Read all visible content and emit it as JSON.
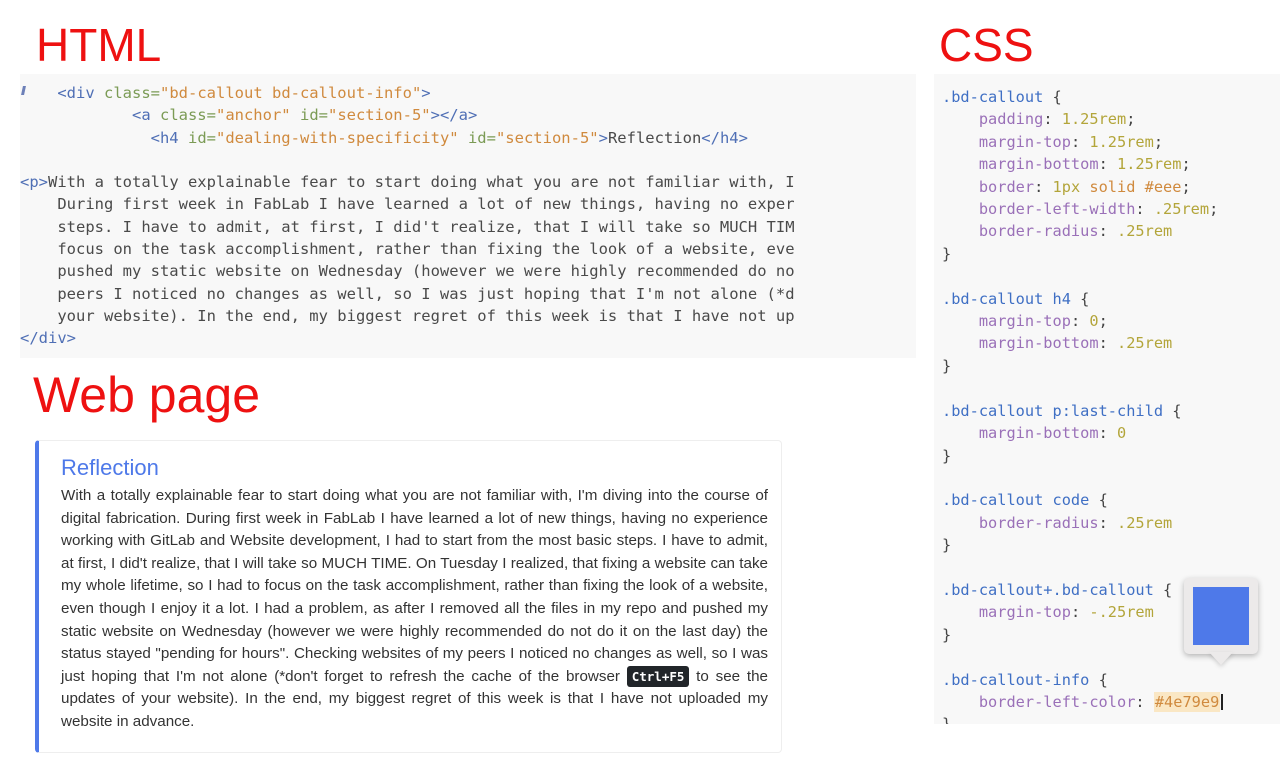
{
  "headings": {
    "html": "HTML",
    "css": "CSS",
    "webpage": "Web page"
  },
  "colors": {
    "heading_red": "#ee1111",
    "callout_border_left": "#4e79e9",
    "callout_heading": "#4e79e9",
    "code_panel_bg": "#f8f8f8",
    "kbd_bg": "#212529",
    "hex_highlight_bg": "#fae7c4"
  },
  "html_panel": {
    "lines": [
      {
        "indent": 0,
        "parts": [
          {
            "t": "tag",
            "v": "    <div "
          },
          {
            "t": "attr",
            "v": "class="
          },
          {
            "t": "str",
            "v": "\"bd-callout bd-callout-info\""
          },
          {
            "t": "tag",
            "v": ">"
          }
        ]
      },
      {
        "indent": 0,
        "parts": [
          {
            "t": "tag",
            "v": "            <a "
          },
          {
            "t": "attr",
            "v": "class="
          },
          {
            "t": "str",
            "v": "\"anchor\" "
          },
          {
            "t": "attr",
            "v": "id="
          },
          {
            "t": "str",
            "v": "\"section-5\""
          },
          {
            "t": "tag",
            "v": "></a>"
          }
        ]
      },
      {
        "indent": 0,
        "parts": [
          {
            "t": "tag",
            "v": "              <h4 "
          },
          {
            "t": "attr",
            "v": "id="
          },
          {
            "t": "str",
            "v": "\"dealing-with-specificity\" "
          },
          {
            "t": "attr",
            "v": "id="
          },
          {
            "t": "str",
            "v": "\"section-5\""
          },
          {
            "t": "tag",
            "v": ">"
          },
          {
            "t": "plain",
            "v": "Reflection"
          },
          {
            "t": "tag",
            "v": "</h4>"
          }
        ]
      },
      {
        "indent": 0,
        "parts": []
      },
      {
        "indent": 0,
        "parts": [
          {
            "t": "tag",
            "v": "<p>"
          },
          {
            "t": "plain",
            "v": "With a totally explainable fear to start doing what you are not familiar with, I"
          }
        ]
      },
      {
        "indent": 0,
        "parts": [
          {
            "t": "plain",
            "v": "    During first week in FabLab I have learned a lot of new things, having no exper"
          }
        ]
      },
      {
        "indent": 0,
        "parts": [
          {
            "t": "plain",
            "v": "    steps. I have to admit, at first, I did't realize, that I will take so MUCH TIM"
          }
        ]
      },
      {
        "indent": 0,
        "parts": [
          {
            "t": "plain",
            "v": "    focus on the task accomplishment, rather than fixing the look of a website, eve"
          }
        ]
      },
      {
        "indent": 0,
        "parts": [
          {
            "t": "plain",
            "v": "    pushed my static website on Wednesday (however we were highly recommended do no"
          }
        ]
      },
      {
        "indent": 0,
        "parts": [
          {
            "t": "plain",
            "v": "    peers I noticed no changes as well, so I was just hoping that I'm not alone (*d"
          }
        ]
      },
      {
        "indent": 0,
        "parts": [
          {
            "t": "plain",
            "v": "    your website). In the end, my biggest regret of this week is that I have not up"
          }
        ]
      },
      {
        "indent": 0,
        "parts": [
          {
            "t": "tag",
            "v": "</div>"
          }
        ]
      }
    ]
  },
  "css_panel": {
    "lines": [
      {
        "parts": [
          {
            "t": "sel",
            "v": ".bd-callout "
          },
          {
            "t": "brace",
            "v": "{"
          }
        ]
      },
      {
        "parts": [
          {
            "t": "prop",
            "v": "    padding"
          },
          {
            "t": "brace",
            "v": ": "
          },
          {
            "t": "num",
            "v": "1.25rem"
          },
          {
            "t": "brace",
            "v": ";"
          }
        ]
      },
      {
        "parts": [
          {
            "t": "prop",
            "v": "    margin-top"
          },
          {
            "t": "brace",
            "v": ": "
          },
          {
            "t": "num",
            "v": "1.25rem"
          },
          {
            "t": "brace",
            "v": ";"
          }
        ]
      },
      {
        "parts": [
          {
            "t": "prop",
            "v": "    margin-bottom"
          },
          {
            "t": "brace",
            "v": ": "
          },
          {
            "t": "num",
            "v": "1.25rem"
          },
          {
            "t": "brace",
            "v": ";"
          }
        ]
      },
      {
        "parts": [
          {
            "t": "prop",
            "v": "    border"
          },
          {
            "t": "brace",
            "v": ": "
          },
          {
            "t": "num",
            "v": "1px "
          },
          {
            "t": "kw",
            "v": "solid #eee"
          },
          {
            "t": "brace",
            "v": ";"
          }
        ]
      },
      {
        "parts": [
          {
            "t": "prop",
            "v": "    border-left-width"
          },
          {
            "t": "brace",
            "v": ": "
          },
          {
            "t": "num",
            "v": ".25rem"
          },
          {
            "t": "brace",
            "v": ";"
          }
        ]
      },
      {
        "parts": [
          {
            "t": "prop",
            "v": "    border-radius"
          },
          {
            "t": "brace",
            "v": ": "
          },
          {
            "t": "num",
            "v": ".25rem"
          }
        ]
      },
      {
        "parts": [
          {
            "t": "brace",
            "v": "}"
          }
        ]
      },
      {
        "parts": []
      },
      {
        "parts": [
          {
            "t": "sel",
            "v": ".bd-callout h4 "
          },
          {
            "t": "brace",
            "v": "{"
          }
        ]
      },
      {
        "parts": [
          {
            "t": "prop",
            "v": "    margin-top"
          },
          {
            "t": "brace",
            "v": ": "
          },
          {
            "t": "num",
            "v": "0"
          },
          {
            "t": "brace",
            "v": ";"
          }
        ]
      },
      {
        "parts": [
          {
            "t": "prop",
            "v": "    margin-bottom"
          },
          {
            "t": "brace",
            "v": ": "
          },
          {
            "t": "num",
            "v": ".25rem"
          }
        ]
      },
      {
        "parts": [
          {
            "t": "brace",
            "v": "}"
          }
        ]
      },
      {
        "parts": []
      },
      {
        "parts": [
          {
            "t": "sel",
            "v": ".bd-callout p:last-child "
          },
          {
            "t": "brace",
            "v": "{"
          }
        ]
      },
      {
        "parts": [
          {
            "t": "prop",
            "v": "    margin-bottom"
          },
          {
            "t": "brace",
            "v": ": "
          },
          {
            "t": "num",
            "v": "0"
          }
        ]
      },
      {
        "parts": [
          {
            "t": "brace",
            "v": "}"
          }
        ]
      },
      {
        "parts": []
      },
      {
        "parts": [
          {
            "t": "sel",
            "v": ".bd-callout code "
          },
          {
            "t": "brace",
            "v": "{"
          }
        ]
      },
      {
        "parts": [
          {
            "t": "prop",
            "v": "    border-radius"
          },
          {
            "t": "brace",
            "v": ": "
          },
          {
            "t": "num",
            "v": ".25rem"
          }
        ]
      },
      {
        "parts": [
          {
            "t": "brace",
            "v": "}"
          }
        ]
      },
      {
        "parts": []
      },
      {
        "parts": [
          {
            "t": "sel",
            "v": ".bd-callout+.bd-callout "
          },
          {
            "t": "brace",
            "v": "{"
          }
        ]
      },
      {
        "parts": [
          {
            "t": "prop",
            "v": "    margin-top"
          },
          {
            "t": "brace",
            "v": ": "
          },
          {
            "t": "num",
            "v": "-.25rem"
          }
        ]
      },
      {
        "parts": [
          {
            "t": "brace",
            "v": "}"
          }
        ]
      },
      {
        "parts": []
      },
      {
        "parts": [
          {
            "t": "sel",
            "v": ".bd-callout-info "
          },
          {
            "t": "brace",
            "v": "{"
          }
        ]
      },
      {
        "parts": [
          {
            "t": "prop",
            "v": "    border-left-color"
          },
          {
            "t": "brace",
            "v": ": "
          },
          {
            "t": "hl",
            "v": "#4e79e9"
          },
          {
            "t": "caret",
            "v": ""
          }
        ]
      },
      {
        "parts": [
          {
            "t": "brace",
            "v": "}"
          }
        ]
      }
    ]
  },
  "webpage": {
    "callout_heading": "Reflection",
    "body_segments": [
      {
        "type": "text",
        "value": "With a totally explainable fear to start doing what you are not familiar with, I'm diving into the course of digital fabrication. During first week in FabLab I have learned a lot of new things, having no experience working with GitLab and Website development, I had to start from the most basic steps. I have to admit, at first, I did't realize, that I will take so MUCH TIME. On Tuesday I realized, that fixing a website can take my whole lifetime, so I had to focus on the task accomplishment, rather than fixing the look of a website, even though I enjoy it a lot. I had a problem, as after I removed all the files in my repo and pushed my static website on Wednesday (however we were highly recommended do not do it on the last day) the status stayed \"pending for hours\". Checking websites of my peers I noticed no changes as well, so I was just hoping that I'm not alone (*don't forget to refresh the cache of the browser "
      },
      {
        "type": "kbd",
        "value": "Ctrl+F5"
      },
      {
        "type": "text",
        "value": " to see the updates of your website). In the end, my biggest regret of this week is that I have not uploaded my website in advance."
      }
    ]
  },
  "color_picker": {
    "swatch_color": "#4e79e9"
  }
}
